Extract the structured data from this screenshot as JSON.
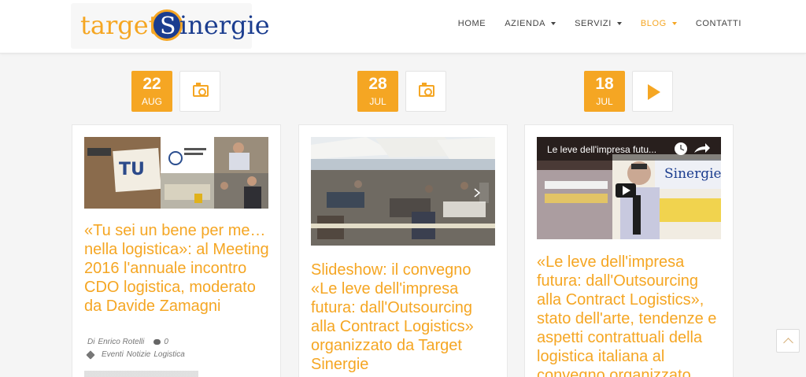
{
  "brand": {
    "part1": "target",
    "monogram": "S",
    "part2": "inergie"
  },
  "nav": [
    {
      "label": "HOME",
      "dropdown": false,
      "active": false
    },
    {
      "label": "AZIENDA",
      "dropdown": true,
      "active": false
    },
    {
      "label": "SERVIZI",
      "dropdown": true,
      "active": false
    },
    {
      "label": "BLOG",
      "dropdown": true,
      "active": true
    },
    {
      "label": "CONTATTI",
      "dropdown": false,
      "active": false
    }
  ],
  "posts": [
    {
      "day": "22",
      "month": "AUG",
      "format_icon": "camera-icon",
      "title": "«Tu sei un bene per me… nella logistica»: al Meeting 2016 l'annuale incontro CDO logistica, moderato da Davide Zamagni",
      "by": "Di",
      "author": "Enrico Rotelli",
      "comments": "0",
      "categories": [
        "Eventi",
        "Notizie",
        "Logistica"
      ]
    },
    {
      "day": "28",
      "month": "JUL",
      "format_icon": "camera-icon",
      "title": "Slideshow: il convegno «Le leve dell'impresa futura: dall'Outsourcing alla Contract Logistics» organizzato da Target Sinergie"
    },
    {
      "day": "18",
      "month": "JUL",
      "format_icon": "play-icon",
      "title": "«Le leve dell'impresa futura: dall'Outsourcing alla Contract Logistics», stato dell'arte, tendenze e aspetti contrattuali della logistica italiana al convegno organizzato",
      "video_title": "Le leve dell'impresa futu..."
    }
  ],
  "colors": {
    "accent": "#f5a623",
    "brand_blue": "#1b3d8f",
    "nav_text": "#444444"
  }
}
